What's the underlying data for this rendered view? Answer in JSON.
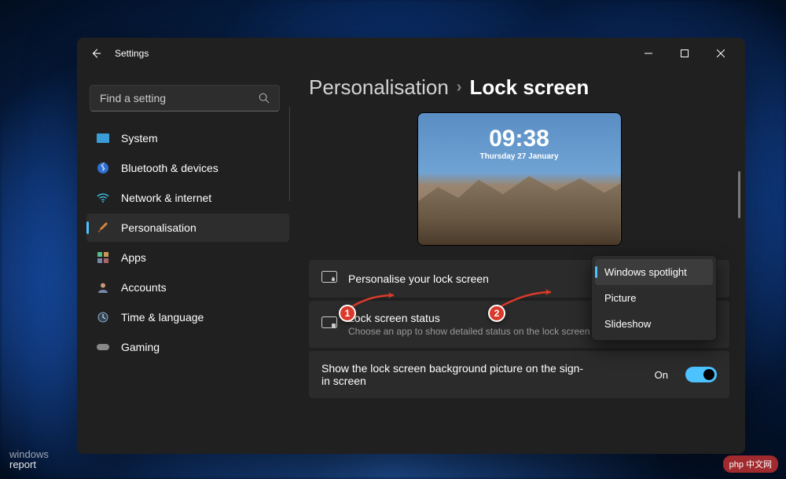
{
  "window": {
    "title": "Settings",
    "search_placeholder": "Find a setting"
  },
  "sidebar": {
    "items": [
      {
        "label": "System",
        "icon": "system",
        "selected": false
      },
      {
        "label": "Bluetooth & devices",
        "icon": "bluetooth",
        "selected": false
      },
      {
        "label": "Network & internet",
        "icon": "wifi",
        "selected": false
      },
      {
        "label": "Personalisation",
        "icon": "brush",
        "selected": true
      },
      {
        "label": "Apps",
        "icon": "apps",
        "selected": false
      },
      {
        "label": "Accounts",
        "icon": "account",
        "selected": false
      },
      {
        "label": "Time & language",
        "icon": "clock",
        "selected": false
      },
      {
        "label": "Gaming",
        "icon": "gaming",
        "selected": false
      }
    ]
  },
  "breadcrumb": {
    "parent": "Personalisation",
    "current": "Lock screen"
  },
  "preview": {
    "time": "09:38",
    "date": "Thursday 27 January"
  },
  "cards": {
    "personalise": {
      "title": "Personalise your lock screen",
      "dropdown": {
        "options": [
          "Windows spotlight",
          "Picture",
          "Slideshow"
        ],
        "selected": "Windows spotlight"
      }
    },
    "status": {
      "title": "Lock screen status",
      "subtitle": "Choose an app to show detailed status on the lock screen"
    },
    "show_bg": {
      "title": "Show the lock screen background picture on the sign-in screen",
      "toggle_label": "On",
      "toggle_value": true
    }
  },
  "annotations": {
    "m1": "1",
    "m2": "2"
  },
  "watermarks": {
    "left_top": "windows",
    "left_bottom": "report",
    "right": "php 中文网"
  }
}
